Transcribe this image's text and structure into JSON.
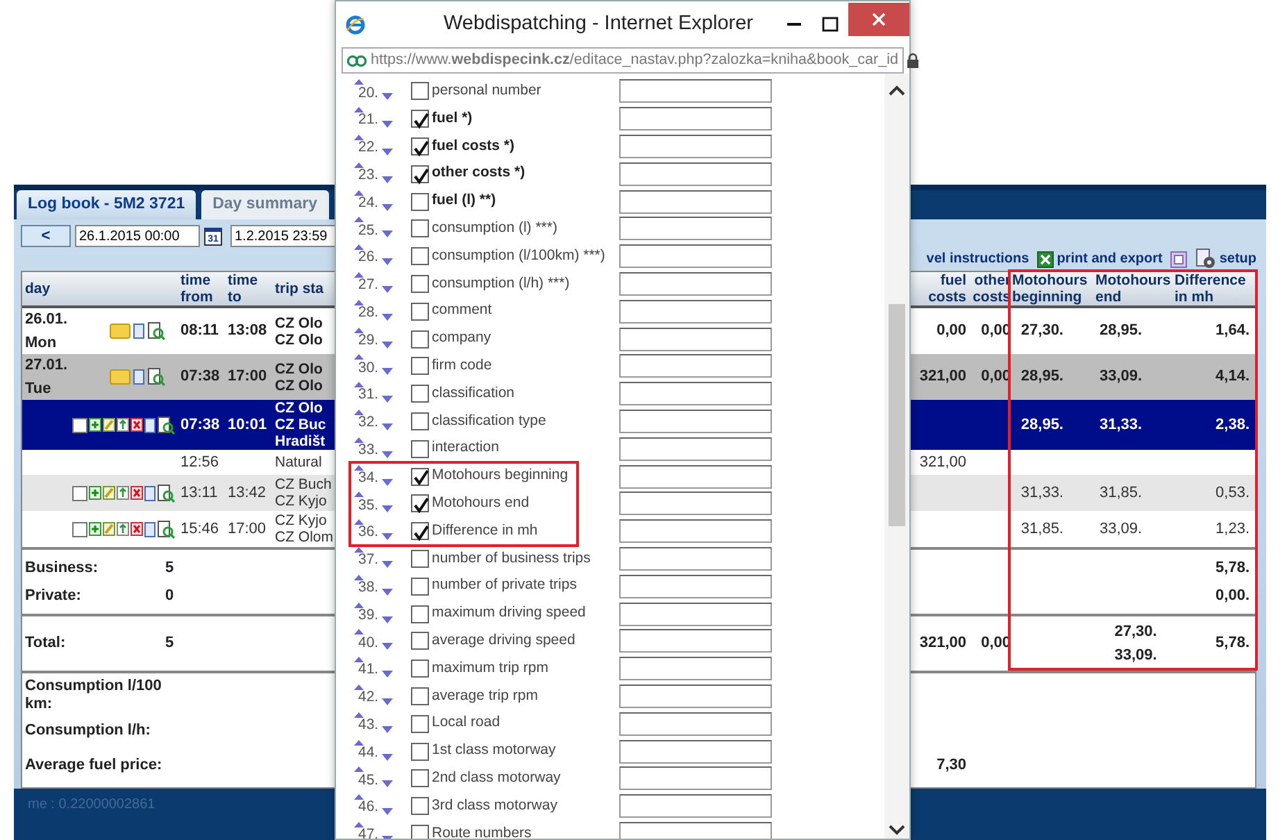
{
  "log_book": {
    "tabs": [
      {
        "label": "Log book - 5M2 3721",
        "selected": true
      },
      {
        "label": "Day summary",
        "selected": false
      }
    ],
    "prev_button": "<",
    "date_from": "26.1.2015 00:00",
    "calendar_day": "31",
    "date_to": "1.2.2015 23:59",
    "toolbar": [
      {
        "kind": "link",
        "label": "vel instructions"
      },
      {
        "kind": "export",
        "label": "print and export"
      },
      {
        "kind": "setup",
        "label": "setup"
      }
    ],
    "columns_left": [
      {
        "label": "day"
      },
      {
        "label": "time from"
      },
      {
        "label": "time to"
      },
      {
        "label": "trip sta"
      }
    ],
    "column_groups": [
      {
        "highlighted": false,
        "columns": [
          {
            "label": "fuel costs"
          },
          {
            "label": "other costs"
          }
        ]
      },
      {
        "highlighted": true,
        "columns": [
          {
            "label": "Motohours beginning"
          },
          {
            "label": "Motohours end"
          },
          {
            "label": "Difference in mh"
          }
        ]
      }
    ],
    "rows": [
      {
        "kind": "day",
        "selected": false,
        "shaded": false,
        "day": "26.01.",
        "weekday": "Mon",
        "time_from": "08:11",
        "time_to": "13:08",
        "trip_start": [
          "CZ Olo",
          "CZ Olo"
        ],
        "fuel_costs": "0,00",
        "other_costs": "0,00",
        "mh_begin": "27,30.",
        "mh_end": "28,95.",
        "mh_diff": "1,64."
      },
      {
        "kind": "day",
        "selected": false,
        "shaded": true,
        "day": "27.01.",
        "weekday": "Tue",
        "time_from": "07:38",
        "time_to": "17:00",
        "trip_start": [
          "CZ Olo",
          "CZ Olo"
        ],
        "fuel_costs": "321,00",
        "other_costs": "0,00",
        "mh_begin": "28,95.",
        "mh_end": "33,09.",
        "mh_diff": "4,14."
      },
      {
        "kind": "trip",
        "selected": true,
        "shaded": false,
        "checked": false,
        "time_from": "07:38",
        "time_to": "10:01",
        "trip_start": [
          "CZ Olo",
          "CZ Buc",
          "Hradišt"
        ],
        "mh_begin": "28,95.",
        "mh_end": "31,33.",
        "mh_diff": "2,38."
      },
      {
        "kind": "stop",
        "selected": false,
        "shaded": false,
        "time_from": "12:56",
        "trip_start": [
          "Natural"
        ],
        "fuel_costs": "321,00"
      },
      {
        "kind": "trip",
        "selected": false,
        "shaded": true,
        "checked": false,
        "time_from": "13:11",
        "time_to": "13:42",
        "trip_start": [
          "CZ Buch",
          "CZ Kyjo"
        ],
        "mh_begin": "31,33.",
        "mh_end": "31,85.",
        "mh_diff": "0,53."
      },
      {
        "kind": "trip",
        "selected": false,
        "shaded": false,
        "checked": false,
        "time_from": "15:46",
        "time_to": "17:00",
        "trip_start": [
          "CZ Kyjo",
          "CZ Olom"
        ],
        "mh_begin": "31,85.",
        "mh_end": "33,09.",
        "mh_diff": "1,23."
      }
    ],
    "summary_groups": [
      {
        "rows": [
          {
            "kind": "count",
            "label": "Business:",
            "value": "5",
            "mh_diff": "5,78."
          },
          {
            "kind": "count",
            "label": "Private:",
            "value": "0",
            "mh_diff": "0,00."
          }
        ]
      },
      {
        "rows": [
          {
            "kind": "total",
            "label": "Total:",
            "value": "5",
            "fuel_costs": "321,00",
            "other_costs": "0,00",
            "mh_end": [
              "27,30.",
              "33,09."
            ],
            "mh_diff": "5,78."
          }
        ]
      },
      {
        "rows": [
          {
            "kind": "stat",
            "label": "Consumption l/100 km:"
          },
          {
            "kind": "stat",
            "label": "Consumption l/h:"
          },
          {
            "kind": "stat",
            "label": "Average fuel price:",
            "fuel_costs": "7,30"
          }
        ]
      }
    ],
    "footer": "me : 0.22000002861"
  },
  "popup": {
    "title": "Webdispatching - Internet Explorer",
    "url": "https://www.**webdispecink.cz**/editace_nastav.php?zalozka=kniha&book_car_id",
    "groups": [
      {
        "highlighted": false,
        "items": [
          {
            "number": "20.",
            "label": "personal number",
            "checked": false,
            "bold": false
          },
          {
            "number": "21.",
            "label": "fuel *)",
            "checked": true,
            "bold": true
          },
          {
            "number": "22.",
            "label": "fuel costs *)",
            "checked": true,
            "bold": true
          },
          {
            "number": "23.",
            "label": "other costs *)",
            "checked": true,
            "bold": true
          },
          {
            "number": "24.",
            "label": "fuel (l) **)",
            "checked": false,
            "bold": true
          },
          {
            "number": "25.",
            "label": "consumption (l) ***)",
            "checked": false,
            "bold": false
          },
          {
            "number": "26.",
            "label": "consumption (l/100km) ***)",
            "checked": false,
            "bold": false
          },
          {
            "number": "27.",
            "label": "consumption (l/h) ***)",
            "checked": false,
            "bold": false
          },
          {
            "number": "28.",
            "label": "comment",
            "checked": false,
            "bold": false
          },
          {
            "number": "29.",
            "label": "company",
            "checked": false,
            "bold": false
          },
          {
            "number": "30.",
            "label": "firm code",
            "checked": false,
            "bold": false
          },
          {
            "number": "31.",
            "label": "classification",
            "checked": false,
            "bold": false
          },
          {
            "number": "32.",
            "label": "classification type",
            "checked": false,
            "bold": false
          },
          {
            "number": "33.",
            "label": "interaction",
            "checked": false,
            "bold": false
          }
        ]
      },
      {
        "highlighted": true,
        "items": [
          {
            "number": "34.",
            "label": "Motohours beginning",
            "checked": true,
            "bold": false
          },
          {
            "number": "35.",
            "label": "Motohours end",
            "checked": true,
            "bold": false
          },
          {
            "number": "36.",
            "label": "Difference in mh",
            "checked": true,
            "bold": false
          }
        ]
      },
      {
        "highlighted": false,
        "items": [
          {
            "number": "37.",
            "label": "number of business trips",
            "checked": false,
            "bold": false
          },
          {
            "number": "38.",
            "label": "number of private trips",
            "checked": false,
            "bold": false
          },
          {
            "number": "39.",
            "label": "maximum driving speed",
            "checked": false,
            "bold": false
          },
          {
            "number": "40.",
            "label": "average driving speed",
            "checked": false,
            "bold": false
          },
          {
            "number": "41.",
            "label": "maximum trip rpm",
            "checked": false,
            "bold": false
          },
          {
            "number": "42.",
            "label": "average trip rpm",
            "checked": false,
            "bold": false
          },
          {
            "number": "43.",
            "label": "Local road",
            "checked": false,
            "bold": false
          },
          {
            "number": "44.",
            "label": "1st class motorway",
            "checked": false,
            "bold": false
          },
          {
            "number": "45.",
            "label": "2nd class motorway",
            "checked": false,
            "bold": false
          },
          {
            "number": "46.",
            "label": "3rd class motorway",
            "checked": false,
            "bold": false
          },
          {
            "number": "47.",
            "label": "Route numbers",
            "checked": false,
            "bold": false
          }
        ]
      }
    ]
  }
}
